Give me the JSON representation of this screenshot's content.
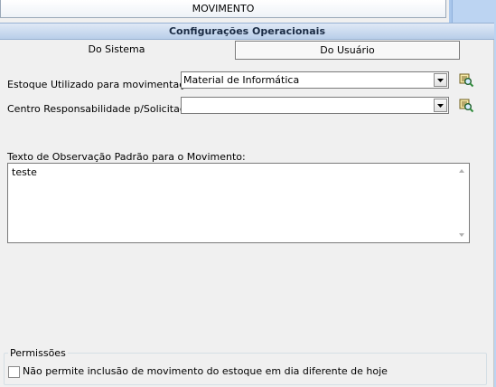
{
  "top_tab": {
    "label": "MOVIMENTO"
  },
  "section_header": {
    "title": "Configurações Operacionais"
  },
  "tabs": [
    {
      "label": "Do Sistema",
      "active": true
    },
    {
      "label": "Do Usuário",
      "active": false
    }
  ],
  "form": {
    "estoque": {
      "label": "Estoque Utilizado para movimentação:",
      "value": "Material de Informática"
    },
    "centro": {
      "label": "Centro Responsabilidade p/Solicitações",
      "value": ""
    },
    "observacao": {
      "label": "Texto de Observação Padrão para o Movimento:",
      "value": "teste"
    }
  },
  "permissions": {
    "title": "Permissões",
    "items": [
      {
        "label": "Não permite inclusão de movimento do estoque em dia diferente de hoje",
        "checked": false
      }
    ]
  },
  "icons": {
    "combo_button": "chevron-down-icon",
    "lookup": "search-tool-icon",
    "scroll_up": "scroll-up-arrow",
    "scroll_down": "scroll-down-arrow"
  },
  "colors": {
    "header_bg": "#c9dbf1",
    "side_strip": "#bcd4f2"
  }
}
